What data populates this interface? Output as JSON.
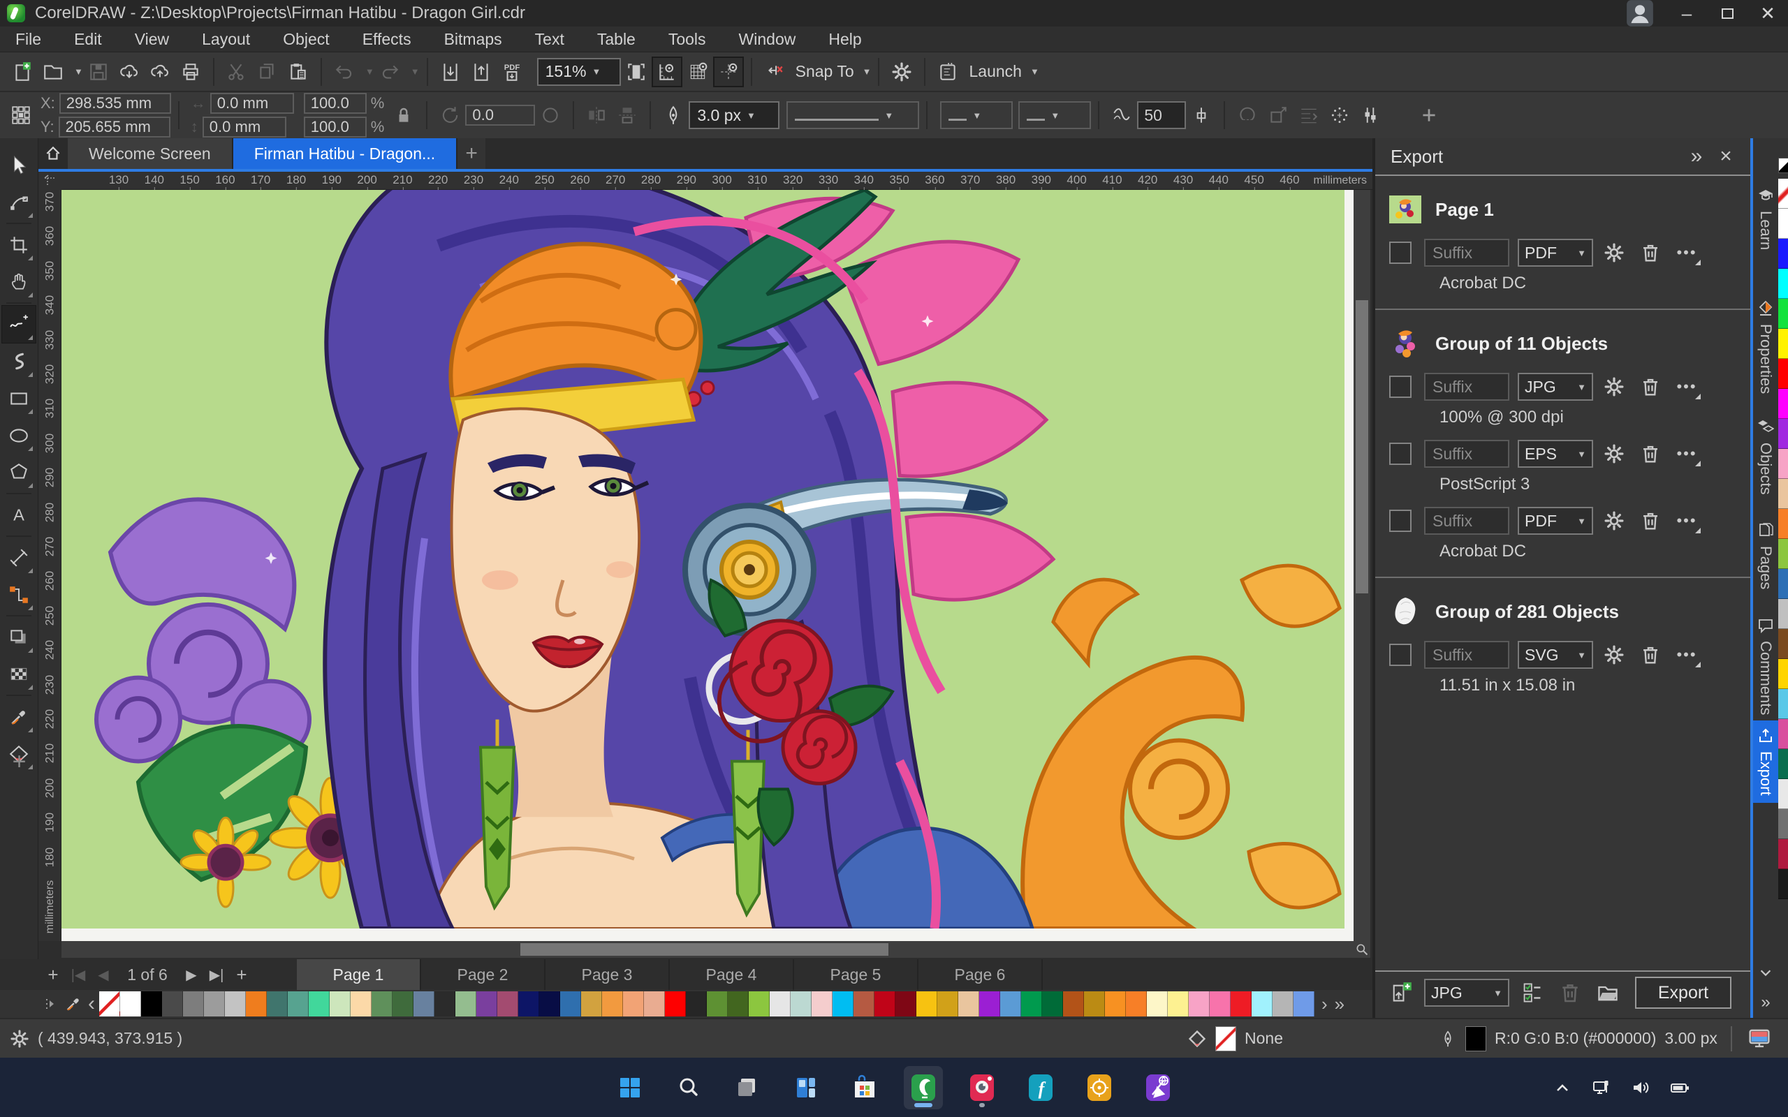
{
  "titlebar": {
    "app_title": "CorelDRAW - Z:\\Desktop\\Projects\\Firman Hatibu - Dragon Girl.cdr"
  },
  "menubar": {
    "items": [
      "File",
      "Edit",
      "View",
      "Layout",
      "Object",
      "Effects",
      "Bitmaps",
      "Text",
      "Table",
      "Tools",
      "Window",
      "Help"
    ]
  },
  "toolbar": {
    "zoom_level": "151%",
    "pdf_label": "PDF",
    "snap_to_label": "Snap To",
    "launch_label": "Launch"
  },
  "propbar": {
    "x_label": "X:",
    "x_value": "298.535 mm",
    "y_label": "Y:",
    "y_value": "205.655 mm",
    "width_value": "0.0 mm",
    "height_value": "0.0 mm",
    "scale_x_value": "100.0",
    "scale_y_value": "100.0",
    "percent": "%",
    "rotation_value": "0.0",
    "outline_width": "3.0 px",
    "smoothness": "50"
  },
  "doctabs": {
    "tabs": [
      {
        "label": "Welcome Screen",
        "active": false
      },
      {
        "label": "Firman Hatibu - Dragon...",
        "active": true
      }
    ]
  },
  "hruler": {
    "unit": "millimeters",
    "ticks": [
      130,
      140,
      150,
      160,
      170,
      180,
      190,
      200,
      210,
      220,
      230,
      240,
      250,
      260,
      270,
      280,
      290,
      300,
      310,
      320,
      330,
      340,
      350,
      360,
      370,
      380,
      390,
      400,
      410,
      420,
      430,
      440,
      450,
      460
    ]
  },
  "vruler": {
    "unit": "millimeters",
    "ticks": [
      370,
      360,
      350,
      340,
      330,
      320,
      310,
      300,
      290,
      280,
      270,
      260,
      250,
      240,
      230,
      220,
      210,
      200,
      190,
      180
    ]
  },
  "toolbox": {
    "tools": [
      {
        "name": "pick-tool"
      },
      {
        "name": "shape-tool"
      },
      {
        "name": "crop-tool"
      },
      {
        "name": "pan-tool"
      },
      {
        "name": "freehand-tool",
        "active": true
      },
      {
        "name": "artistic-media-tool"
      },
      {
        "name": "rectangle-tool"
      },
      {
        "name": "ellipse-tool"
      },
      {
        "name": "polygon-tool"
      },
      {
        "name": "text-tool"
      },
      {
        "name": "dimension-tool"
      },
      {
        "name": "connector-tool"
      },
      {
        "name": "drop-shadow-tool"
      },
      {
        "name": "transparency-tool"
      },
      {
        "name": "color-eyedropper-tool"
      },
      {
        "name": "interactive-fill-tool"
      }
    ]
  },
  "canvas": {
    "background_color": "#b7da8c",
    "artwork_colors": {
      "hair": "#5646a8",
      "skin": "#f8d8b5",
      "turban": "#f28c28",
      "horn_green": "#1f7050",
      "petal_pink": "#ee5fa8",
      "rose_red": "#cc2135",
      "swirl_orange": "#f2992e",
      "foliage_purple": "#9a6fd0",
      "sunflower": "#f6c51c"
    }
  },
  "export_panel": {
    "title": "Export",
    "suffix_placeholder": "Suffix",
    "groups": [
      {
        "title": "Page 1",
        "items": [
          {
            "format": "PDF",
            "detail": "Acrobat DC"
          }
        ]
      },
      {
        "title": "Group of 11 Objects",
        "items": [
          {
            "format": "JPG",
            "detail": "100% @ 300 dpi"
          },
          {
            "format": "EPS",
            "detail": "PostScript 3"
          },
          {
            "format": "PDF",
            "detail": "Acrobat DC"
          }
        ]
      },
      {
        "title": "Group of 281 Objects",
        "items": [
          {
            "format": "SVG",
            "detail": "11.51 in x 15.08 in"
          }
        ]
      }
    ],
    "footer": {
      "format": "JPG",
      "export_button": "Export"
    }
  },
  "dock": {
    "tabs": [
      {
        "label": "Learn"
      },
      {
        "label": "Properties"
      },
      {
        "label": "Objects"
      },
      {
        "label": "Pages"
      },
      {
        "label": "Comments"
      },
      {
        "label": "Export",
        "active": true
      }
    ]
  },
  "pagebar": {
    "counter": "1 of 6",
    "pages": [
      {
        "label": "Page 1",
        "active": true
      },
      {
        "label": "Page 2"
      },
      {
        "label": "Page 3"
      },
      {
        "label": "Page 4"
      },
      {
        "label": "Page 5"
      },
      {
        "label": "Page 6"
      }
    ]
  },
  "palette": {
    "swatches": [
      "none",
      "#ffffff",
      "#000000",
      "#4a4a4a",
      "#7d7d7d",
      "#9c9c9c",
      "#c3c3c3",
      "#ef7d1e",
      "#40756d",
      "#57a390",
      "#41d79b",
      "#cde6bc",
      "#fcd9a8",
      "#5f905b",
      "#3f6b3c",
      "#68819f",
      "#2b2b2b",
      "#94bd8f",
      "#7a3f9e",
      "#a34b70",
      "#0d1566",
      "#080d45",
      "#2f6fae",
      "#d2a23f",
      "#f29a3f",
      "#f2a375",
      "#e9ac91",
      "#fe0000",
      "#262626",
      "#5e9133",
      "#42661f",
      "#8cc63f",
      "#e6e6e6",
      "#bcd9d2",
      "#f5cdcd",
      "#00bdf2",
      "#b55a42",
      "#c00418",
      "#7f0715",
      "#f7c211",
      "#d1a119",
      "#e9c59e",
      "#9b1fd3",
      "#5b9bd5",
      "#009a4e",
      "#006b38",
      "#b35318",
      "#bb8b14",
      "#f79122",
      "#f77f27",
      "#fdf6c8",
      "#fdf191",
      "#f7a3c6",
      "#f773ab",
      "#ee1c25",
      "#a1f1fd",
      "#b5b5b5",
      "#6f9be8"
    ]
  },
  "right_palette": {
    "swatches": [
      "none",
      "#ffffff",
      "#1a1aff",
      "#00ffff",
      "#12e23c",
      "#fff200",
      "#ff0000",
      "#ff00ff",
      "#a128e0",
      "#f7a3c6",
      "#eac59e",
      "#f77f27",
      "#8cc63f",
      "#2d6fb5",
      "#c0c0c0",
      "#7a4a1f",
      "#ffd400",
      "#5ac8e8",
      "#d94f9e",
      "#0a6e4f",
      "#e8e8e8",
      "#707070",
      "#b01a3f",
      "#1a1a1a"
    ]
  },
  "statusbar": {
    "cursor_coords": "( 439.943, 373.915 )",
    "fill_value": "None",
    "outline_color": "R:0 G:0 B:0 (#000000)",
    "outline_width": "3.00 px"
  },
  "taskbar": {
    "apps": [
      {
        "name": "start"
      },
      {
        "name": "search"
      },
      {
        "name": "task-view"
      },
      {
        "name": "widgets"
      },
      {
        "name": "store"
      },
      {
        "name": "coreldraw",
        "active": true
      },
      {
        "name": "photo-paint",
        "running": true
      },
      {
        "name": "font-manager"
      },
      {
        "name": "capture"
      },
      {
        "name": "corel-vector"
      }
    ],
    "tray": [
      {
        "name": "tray-chevron"
      },
      {
        "name": "network"
      },
      {
        "name": "volume"
      },
      {
        "name": "battery"
      }
    ]
  }
}
